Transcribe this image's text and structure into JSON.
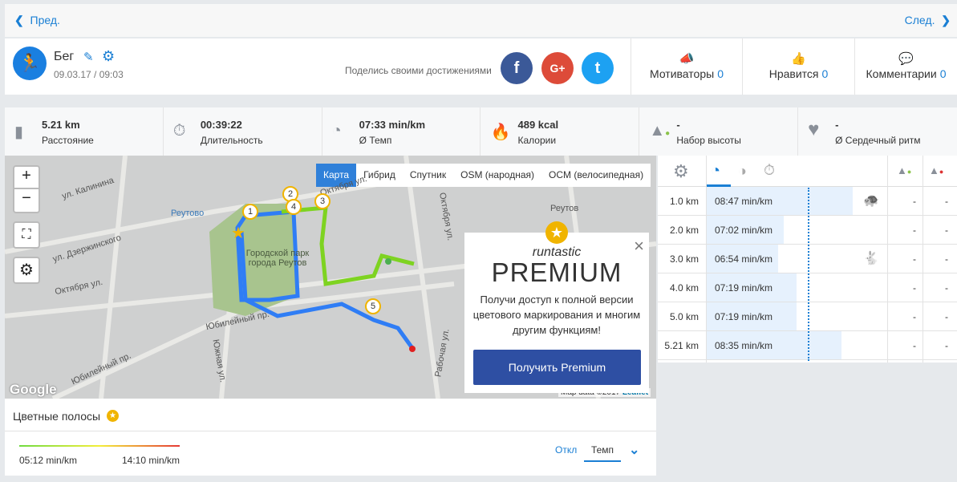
{
  "nav": {
    "prev": "Пред.",
    "next": "След."
  },
  "activity": {
    "title": "Бег",
    "datetime": "09.03.17 / 09:03"
  },
  "share": {
    "label": "Поделись своими достижениями",
    "facebook": "f",
    "google": "G+",
    "twitter": "t"
  },
  "counters": [
    {
      "label": "Мотиваторы",
      "count": "0"
    },
    {
      "label": "Нравится",
      "count": "0"
    },
    {
      "label": "Комментарии",
      "count": "0"
    }
  ],
  "stats": [
    {
      "value": "5.21 km",
      "label": "Расстояние",
      "icon": "road-icon"
    },
    {
      "value": "00:39:22",
      "label": "Длительность",
      "icon": "stopwatch-icon"
    },
    {
      "value": "07:33 min/km",
      "label": "Ø Темп",
      "icon": "pace-icon"
    },
    {
      "value": "489 kcal",
      "label": "Калории",
      "icon": "flame-icon"
    },
    {
      "value": "-",
      "label": "Набор высоты",
      "icon": "elevation-up-icon"
    },
    {
      "value": "-",
      "label": "Ø Сердечный ритм",
      "icon": "heart-icon"
    }
  ],
  "map": {
    "tabs": [
      "Карта",
      "Гибрид",
      "Спутник",
      "OSM (народная)",
      "OCM (велосипедная)"
    ],
    "zoom_in": "+",
    "zoom_out": "−",
    "labels": [
      "ул. Калинина",
      "Реутово",
      "ул. Дзержинского",
      "Октября ул.",
      "Октября ул.",
      "Городской парк города Реутов",
      "Юбилейный пр.",
      "Южная ул.",
      "Юбилейный пр.",
      "Рабочая ул.",
      "Октября ул.",
      "Реутов"
    ],
    "markers": [
      "1",
      "2",
      "3",
      "4",
      "5"
    ],
    "attribution": "Map data ©2017",
    "leaflet": "Leaflet",
    "google": "Google"
  },
  "premium": {
    "brand": "runtastic",
    "title": "PREMIUM",
    "text": "Получи доступ к полной версии цветового маркирования и многим другим функциям!",
    "button": "Получить Premium"
  },
  "splits": [
    {
      "km": "1.0 km",
      "pace": "08:47 min/km",
      "fill": 0.55,
      "badge": "turtle",
      "up": "-",
      "down": "-"
    },
    {
      "km": "2.0 km",
      "pace": "07:02 min/km",
      "fill": 0.29,
      "badge": "",
      "up": "-",
      "down": "-"
    },
    {
      "km": "3.0 km",
      "pace": "06:54 min/km",
      "fill": 0.27,
      "badge": "rabbit",
      "up": "-",
      "down": "-"
    },
    {
      "km": "4.0 km",
      "pace": "07:19 min/km",
      "fill": 0.34,
      "badge": "",
      "up": "-",
      "down": "-"
    },
    {
      "km": "5.0 km",
      "pace": "07:19 min/km",
      "fill": 0.34,
      "badge": "",
      "up": "-",
      "down": "-"
    },
    {
      "km": "5.21 km",
      "pace": "08:35 min/km",
      "fill": 0.51,
      "badge": "",
      "up": "-",
      "down": "-"
    }
  ],
  "colorbars": {
    "title": "Цветные полосы",
    "min": "05:12 min/km",
    "max": "14:10 min/km",
    "off": "Откл",
    "tempo": "Темп"
  }
}
